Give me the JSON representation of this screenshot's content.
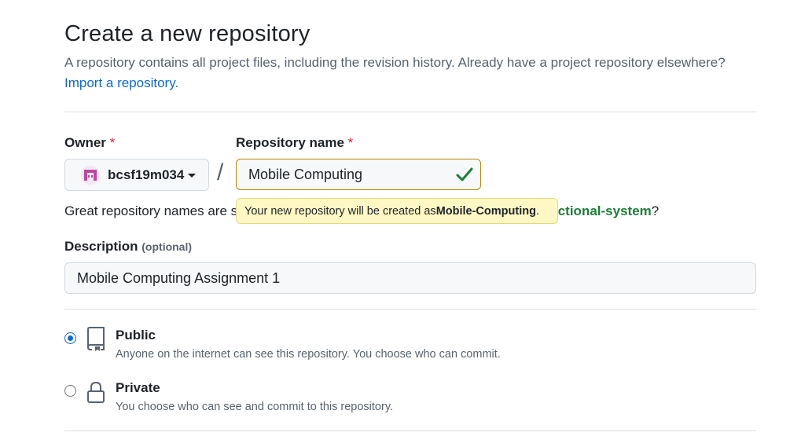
{
  "header": {
    "title": "Create a new repository",
    "intro": "A repository contains all project files, including the revision history. Already have a project repository elsewhere?",
    "import_link": "Import a repository",
    "import_suffix": "."
  },
  "owner": {
    "label": "Owner",
    "required_mark": "*",
    "name": "bcsf19m034",
    "avatar_color": "#c0459f"
  },
  "repository": {
    "label": "Repository name",
    "required_mark": "*",
    "value": "Mobile Computing",
    "separator": "/",
    "valid_icon": "check-icon"
  },
  "name_hint": {
    "prefix": "Great repository names are s",
    "suggestion": "ictional-system",
    "suffix": "?"
  },
  "tooltip": {
    "prefix": "Your new repository will be created as ",
    "repo_slug": "Mobile-Computing",
    "suffix": "."
  },
  "description": {
    "label": "Description",
    "optional": "(optional)",
    "value": "Mobile Computing Assignment 1"
  },
  "visibility": {
    "selected": "public",
    "options": [
      {
        "title": "Public",
        "description": "Anyone on the internet can see this repository. You choose who can commit.",
        "icon": "repo-icon"
      },
      {
        "title": "Private",
        "description": "You choose who can see and commit to this repository.",
        "icon": "lock-icon"
      }
    ]
  },
  "colors": {
    "link": "#0969da",
    "success": "#1a7f37",
    "warning_border": "#bf8700",
    "tooltip_bg": "#fff8c5",
    "required": "#d1242f"
  }
}
